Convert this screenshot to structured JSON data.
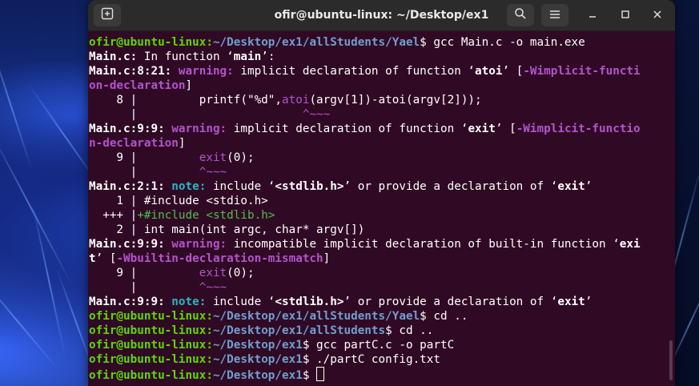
{
  "window": {
    "title": "ofir@ubuntu-linux: ~/Desktop/ex1"
  },
  "icons": {
    "new_tab": "new-tab-icon",
    "search": "search-icon",
    "menu": "hamburger-menu-icon",
    "minimize": "minimize-icon",
    "maximize": "maximize-icon",
    "close": "close-icon"
  },
  "colors": {
    "terminal_bg": "#300a24",
    "prompt_user": "#5fd700",
    "prompt_path": "#729fcf",
    "warning": "#b452cf",
    "note": "#2bb6c3",
    "titlebar": "#2b2b2b"
  },
  "terminal": {
    "lines": [
      [
        {
          "t": "ofir@ubuntu-linux:",
          "c": "g"
        },
        {
          "t": "~/Desktop/ex1/allStudents/Yael",
          "c": "bl"
        },
        {
          "t": "$ gcc Main.c -o main.exe"
        }
      ],
      [
        {
          "t": "Main.c:",
          "c": "b"
        },
        {
          "t": " In function ‘"
        },
        {
          "t": "main",
          "c": "b"
        },
        {
          "t": "’:"
        }
      ],
      [
        {
          "t": "Main.c:8:21:",
          "c": "b"
        },
        {
          "t": " "
        },
        {
          "t": "warning:",
          "c": "mg"
        },
        {
          "t": " implicit declaration of function ‘"
        },
        {
          "t": "atoi",
          "c": "b"
        },
        {
          "t": "’ ["
        },
        {
          "t": "-Wimplicit-functi",
          "c": "mg"
        }
      ],
      [
        {
          "t": "on-declaration",
          "c": "mg"
        },
        {
          "t": "]"
        }
      ],
      [
        {
          "t": "    8 |         printf(\"%d\","
        },
        {
          "t": "atoi",
          "c": "u"
        },
        {
          "t": "(argv[1])-atoi(argv[2]));"
        }
      ],
      [
        {
          "t": "      |                        "
        },
        {
          "t": "^~~~",
          "c": "u"
        }
      ],
      [
        {
          "t": "Main.c:9:9:",
          "c": "b"
        },
        {
          "t": " "
        },
        {
          "t": "warning:",
          "c": "mg"
        },
        {
          "t": " implicit declaration of function ‘"
        },
        {
          "t": "exit",
          "c": "b"
        },
        {
          "t": "’ ["
        },
        {
          "t": "-Wimplicit-functio",
          "c": "mg"
        }
      ],
      [
        {
          "t": "n-declaration",
          "c": "mg"
        },
        {
          "t": "]"
        }
      ],
      [
        {
          "t": "    9 |         "
        },
        {
          "t": "exit",
          "c": "u"
        },
        {
          "t": "(0);"
        }
      ],
      [
        {
          "t": "      |         "
        },
        {
          "t": "^~~~",
          "c": "u"
        }
      ],
      [
        {
          "t": "Main.c:2:1:",
          "c": "b"
        },
        {
          "t": " "
        },
        {
          "t": "note:",
          "c": "cy"
        },
        {
          "t": " include ‘"
        },
        {
          "t": "<stdlib.h>",
          "c": "b"
        },
        {
          "t": "’ or provide a declaration of ‘"
        },
        {
          "t": "exit",
          "c": "b"
        },
        {
          "t": "’"
        }
      ],
      [
        {
          "t": "    1 | #include <stdio.h>"
        }
      ],
      [
        {
          "t": "  +++ |"
        },
        {
          "t": "+#include <stdlib.h>",
          "c": "gr"
        }
      ],
      [
        {
          "t": "    2 | int main(int argc, char* argv[])"
        }
      ],
      [
        {
          "t": "Main.c:9:9:",
          "c": "b"
        },
        {
          "t": " "
        },
        {
          "t": "warning:",
          "c": "mg"
        },
        {
          "t": " incompatible implicit declaration of built-in function ‘"
        },
        {
          "t": "exi",
          "c": "b"
        }
      ],
      [
        {
          "t": "t",
          "c": "b"
        },
        {
          "t": "’ ["
        },
        {
          "t": "-Wbuiltin-declaration-mismatch",
          "c": "mg"
        },
        {
          "t": "]"
        }
      ],
      [
        {
          "t": "    9 |         "
        },
        {
          "t": "exit",
          "c": "u"
        },
        {
          "t": "(0);"
        }
      ],
      [
        {
          "t": "      |         "
        },
        {
          "t": "^~~~",
          "c": "u"
        }
      ],
      [
        {
          "t": "Main.c:9:9:",
          "c": "b"
        },
        {
          "t": " "
        },
        {
          "t": "note:",
          "c": "cy"
        },
        {
          "t": " include ‘"
        },
        {
          "t": "<stdlib.h>",
          "c": "b"
        },
        {
          "t": "’ or provide a declaration of ‘"
        },
        {
          "t": "exit",
          "c": "b"
        },
        {
          "t": "’"
        }
      ],
      [
        {
          "t": "ofir@ubuntu-linux:",
          "c": "g"
        },
        {
          "t": "~/Desktop/ex1/allStudents/Yael",
          "c": "bl"
        },
        {
          "t": "$ cd .."
        }
      ],
      [
        {
          "t": "ofir@ubuntu-linux:",
          "c": "g"
        },
        {
          "t": "~/Desktop/ex1/allStudents",
          "c": "bl"
        },
        {
          "t": "$ cd .."
        }
      ],
      [
        {
          "t": "ofir@ubuntu-linux:",
          "c": "g"
        },
        {
          "t": "~/Desktop/ex1",
          "c": "bl"
        },
        {
          "t": "$ gcc partC.c -o partC"
        }
      ],
      [
        {
          "t": "ofir@ubuntu-linux:",
          "c": "g"
        },
        {
          "t": "~/Desktop/ex1",
          "c": "bl"
        },
        {
          "t": "$ ./partC config.txt"
        }
      ],
      [
        {
          "t": "ofir@ubuntu-linux:",
          "c": "g"
        },
        {
          "t": "~/Desktop/ex1",
          "c": "bl"
        },
        {
          "t": "$ "
        }
      ]
    ]
  }
}
